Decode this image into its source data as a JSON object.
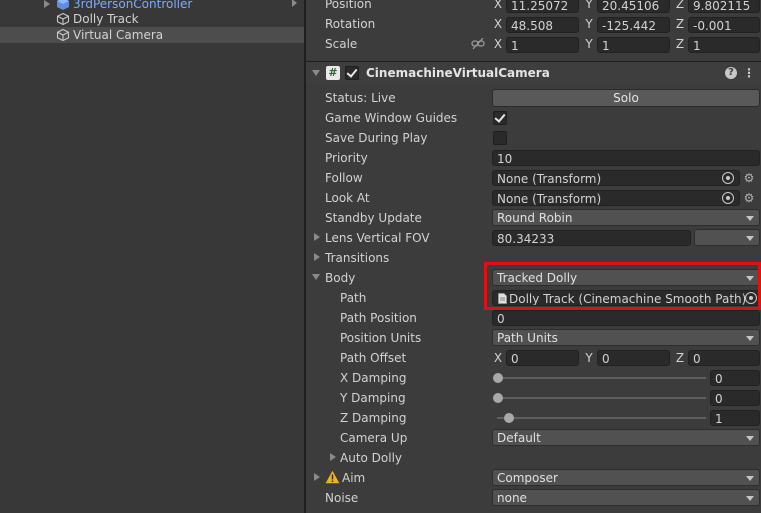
{
  "hierarchy": {
    "items": [
      {
        "label": "3rdPersonController",
        "color": "#7ea9ff"
      },
      {
        "label": "Dolly Track"
      },
      {
        "label": "Virtual Camera",
        "selected": true
      }
    ]
  },
  "transform": {
    "position": {
      "label": "Position",
      "x": "11.25072",
      "y": "20.45106",
      "z": "9.802115"
    },
    "rotation": {
      "label": "Rotation",
      "x": "48.508",
      "y": "-125.442",
      "z": "-0.001"
    },
    "scale": {
      "label": "Scale",
      "x": "1",
      "y": "1",
      "z": "1"
    },
    "axis_x": "X",
    "axis_y": "Y",
    "axis_z": "Z"
  },
  "component": {
    "title": "CinemachineVirtualCamera",
    "script_icon": "#",
    "help_icon": "?",
    "menu_icon": "⋮",
    "enabled": true
  },
  "props": {
    "status_label": "Status: Live",
    "solo_button": "Solo",
    "game_window_guides": {
      "label": "Game Window Guides",
      "checked": true
    },
    "save_during_play": {
      "label": "Save During Play",
      "checked": false
    },
    "priority": {
      "label": "Priority",
      "value": "10"
    },
    "follow": {
      "label": "Follow",
      "value": "None (Transform)"
    },
    "look_at": {
      "label": "Look At",
      "value": "None (Transform)"
    },
    "standby_update": {
      "label": "Standby Update",
      "value": "Round Robin"
    },
    "lens_fov": {
      "label": "Lens Vertical FOV",
      "value": "80.34233"
    },
    "transitions": {
      "label": "Transitions"
    },
    "body": {
      "label": "Body",
      "value": "Tracked Dolly"
    },
    "path": {
      "label": "Path",
      "value": "Dolly Track (Cinemachine Smooth Path)"
    },
    "path_position": {
      "label": "Path Position",
      "value": "0"
    },
    "position_units": {
      "label": "Position Units",
      "value": "Path Units"
    },
    "path_offset": {
      "label": "Path Offset",
      "x": "0",
      "y": "0",
      "z": "0"
    },
    "x_damping": {
      "label": "X Damping",
      "value": "0",
      "level": 0
    },
    "y_damping": {
      "label": "Y Damping",
      "value": "0",
      "level": 0
    },
    "z_damping": {
      "label": "Z Damping",
      "value": "1",
      "level": 0.05
    },
    "camera_up": {
      "label": "Camera Up",
      "value": "Default"
    },
    "auto_dolly": {
      "label": "Auto Dolly"
    },
    "aim": {
      "label": "Aim",
      "value": "Composer"
    },
    "noise": {
      "label": "Noise",
      "value": "none"
    }
  },
  "colors": {
    "highlight": "#e01010",
    "warning": "#f2b01e",
    "link": "#7ea9ff"
  }
}
